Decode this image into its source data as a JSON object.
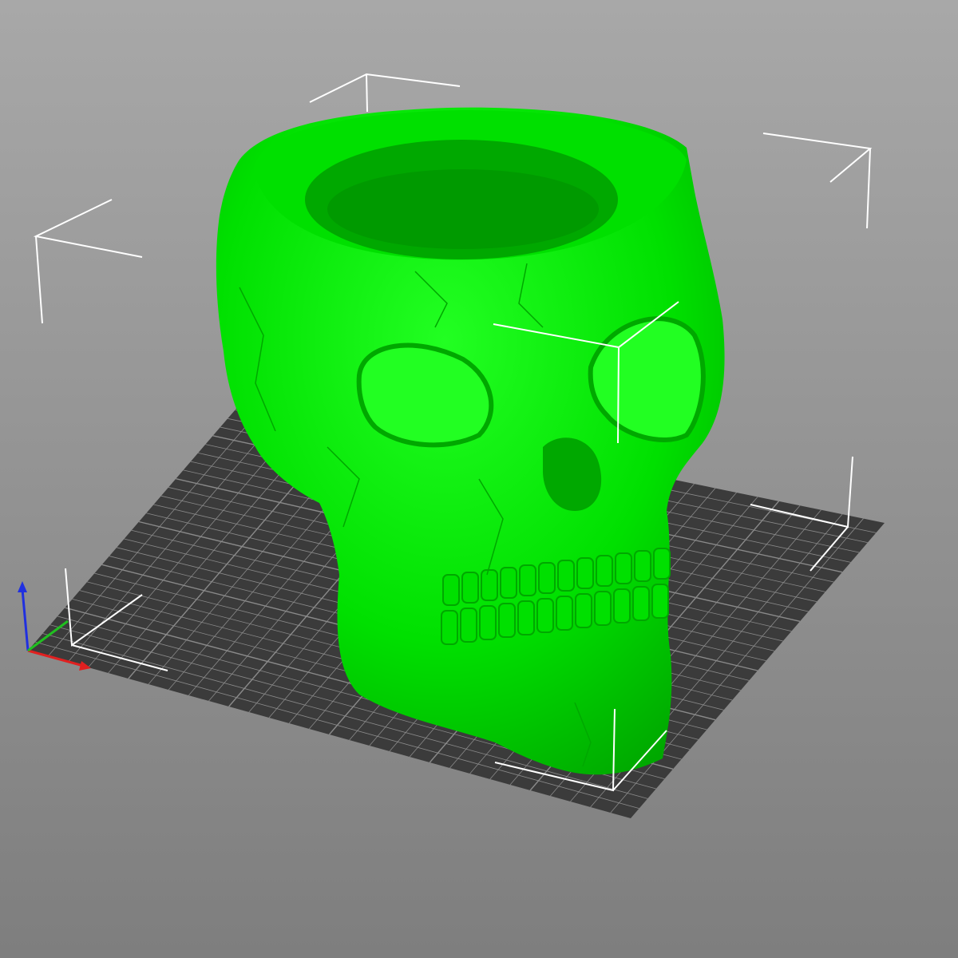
{
  "viewport": {
    "background_top": "#a8a8a8",
    "background_bottom": "#7e7e7e",
    "bed_color": "#3b3b3b",
    "bed_grid_color": "#8a8a8a",
    "model_color": "#00e000",
    "model_shadow": "#00a800",
    "model_highlight": "#22ff22",
    "bounding_box_color": "#ffffff",
    "axis_x_color": "#e02020",
    "axis_y_color": "#20c020",
    "axis_z_color": "#2030e0"
  }
}
